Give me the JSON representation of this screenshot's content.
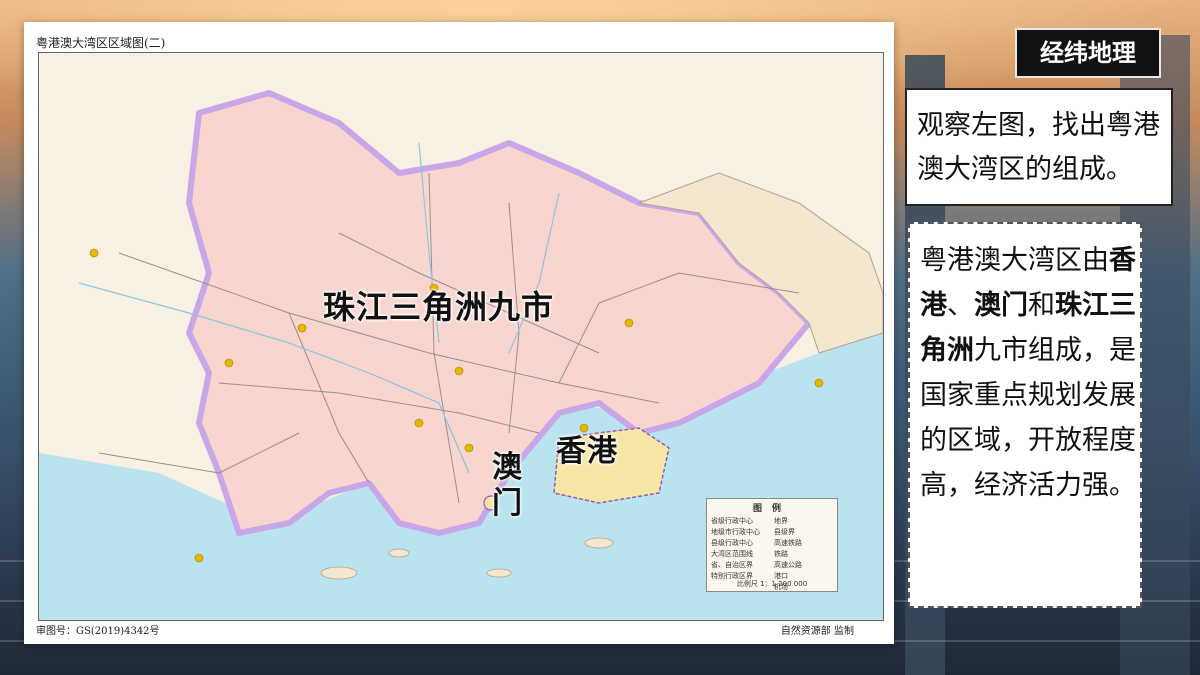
{
  "map": {
    "title": "粤港澳大湾区区域图(二)",
    "approval_number": "审图号：GS(2019)4342号",
    "supervisor": "自然资源部 监制",
    "overlay_labels": {
      "pearl_river_delta": "珠江三角洲九市",
      "hong_kong": "香港",
      "macau": "澳门"
    },
    "legend": {
      "title": "图例",
      "items": [
        "省级行政中心",
        "地界",
        "地级市行政中心",
        "县级界",
        "县级行政中心",
        "高速铁路",
        "大湾区范围线",
        "铁路",
        "省、自治区界",
        "高速公路",
        "特别行政区界",
        "港口",
        "",
        "机场"
      ],
      "scale": "比例尺 1：1 200 000"
    },
    "colors": {
      "land_bay_area": "#f8d6cf",
      "land_outside": "#f7f0e3",
      "sea": "#b9e3ef",
      "boundary": "#c9a6e8",
      "road": "#9a8f8a"
    }
  },
  "brand": {
    "label": "经纬地理"
  },
  "question": {
    "text": "观察左图，找出粤港澳大湾区的组成。"
  },
  "answer": {
    "p1": "粤港澳大湾区由",
    "bold1": "香港",
    "sep1": "、",
    "bold2": "澳门",
    "p2": "和",
    "bold3": "珠江三角洲",
    "p3": "九市组成，是国家重点规划发展的区域，开放程度高，经济活力强。"
  }
}
